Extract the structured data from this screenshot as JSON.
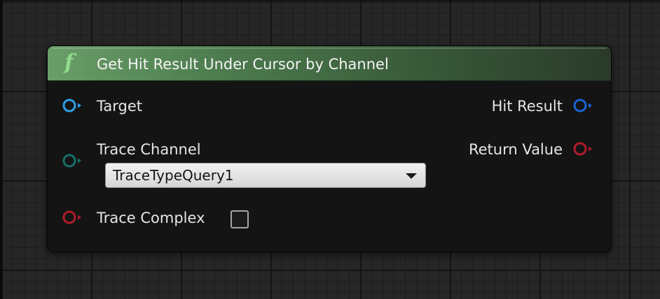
{
  "node": {
    "title": "Get Hit Result Under Cursor by Channel",
    "icon": "function-icon",
    "header_color": "#4d7c4e"
  },
  "inputs": {
    "target": {
      "label": "Target",
      "color": "#2ea0e6"
    },
    "trace_channel": {
      "label": "Trace Channel",
      "color": "#17706a",
      "value": "TraceTypeQuery1"
    },
    "trace_complex": {
      "label": "Trace Complex",
      "color": "#b01c2a",
      "checked": false
    }
  },
  "outputs": {
    "hit_result": {
      "label": "Hit Result",
      "color": "#1a64d6"
    },
    "return_value": {
      "label": "Return Value",
      "color": "#b01c2a"
    }
  }
}
